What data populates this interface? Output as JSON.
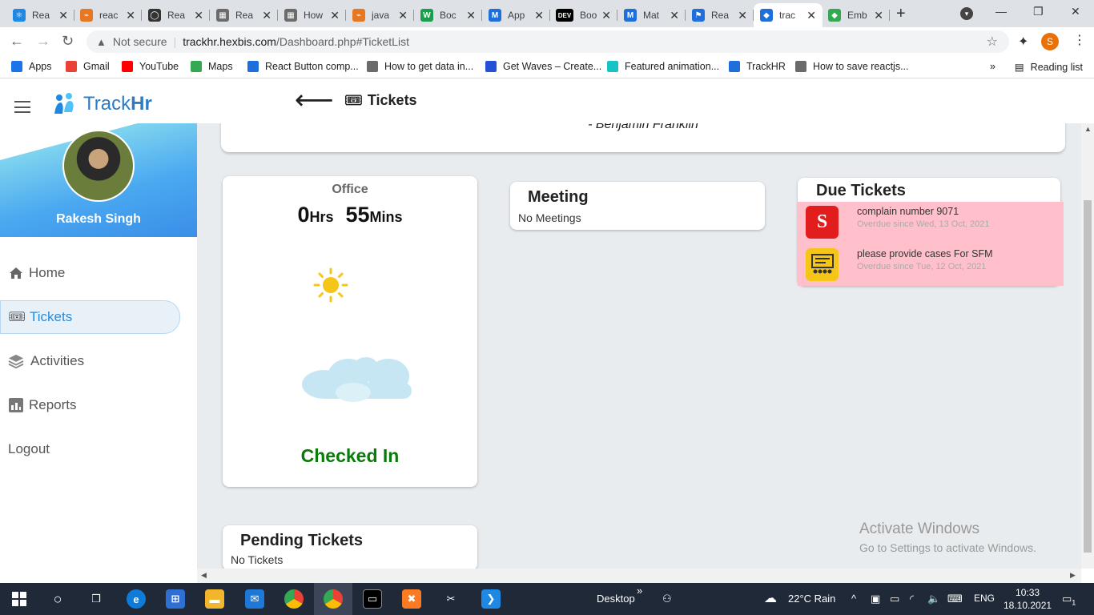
{
  "browser": {
    "tabs": [
      {
        "label": "Rea",
        "fav_color": "#1e88e5",
        "fav": "⚛"
      },
      {
        "label": "reac",
        "fav_color": "#e87722",
        "fav": "⌁"
      },
      {
        "label": "Rea",
        "fav_color": "#333333",
        "fav": "◯"
      },
      {
        "label": "Rea",
        "fav_color": "#6b6b6b",
        "fav": "▦"
      },
      {
        "label": "How",
        "fav_color": "#6b6b6b",
        "fav": "▦"
      },
      {
        "label": "java",
        "fav_color": "#e87722",
        "fav": "⌁"
      },
      {
        "label": "Boc",
        "fav_color": "#1b9e4b",
        "fav": "W"
      },
      {
        "label": "App",
        "fav_color": "#1e6fd9",
        "fav": "M"
      },
      {
        "label": "Boo",
        "fav_color": "#000000",
        "fav": "DEV"
      },
      {
        "label": "Mat",
        "fav_color": "#1e6fd9",
        "fav": "M"
      },
      {
        "label": "Rea",
        "fav_color": "#1e6fd9",
        "fav": "⚑"
      },
      {
        "label": "trac",
        "fav_color": "#1e6fd9",
        "fav": "◆"
      },
      {
        "label": "Emb",
        "fav_color": "#34a853",
        "fav": "◆"
      }
    ],
    "address": {
      "warning": "Not secure",
      "host": "trackhr.hexbis.com",
      "path": "/Dashboard.php#TicketList"
    },
    "profile_initial": "S",
    "bookmarks": [
      {
        "label": "Apps",
        "color": "#1a73e8"
      },
      {
        "label": "Gmail",
        "color": "#ea4335"
      },
      {
        "label": "YouTube",
        "color": "#ff0000"
      },
      {
        "label": "Maps",
        "color": "#34a853"
      },
      {
        "label": "React Button comp...",
        "color": "#1e6fd9"
      },
      {
        "label": "How to get data in...",
        "color": "#6b6b6b"
      },
      {
        "label": "Get Waves – Create...",
        "color": "#2451d6"
      },
      {
        "label": "Featured animation...",
        "color": "#16c4c4"
      },
      {
        "label": "TrackHR",
        "color": "#1e6fd9"
      },
      {
        "label": "How to save reactjs...",
        "color": "#6b6b6b"
      }
    ],
    "more_bookmarks": "»",
    "reading_list": "Reading list"
  },
  "app": {
    "brand_plain": "Track",
    "brand_bold": "Hr",
    "user_name": "Rakesh Singh",
    "menu": [
      {
        "label": "Home",
        "icon": "home-icon"
      },
      {
        "label": "Tickets",
        "icon": "ticket-icon"
      },
      {
        "label": "Activities",
        "icon": "layers-icon"
      },
      {
        "label": "Reports",
        "icon": "report-icon"
      },
      {
        "label": "Logout",
        "icon": ""
      }
    ],
    "page_title": "Tickets",
    "quote_author": "- Benjamin Franklin",
    "office": {
      "label": "Office",
      "hours": "0",
      "hours_unit": "Hrs",
      "mins": "55",
      "mins_unit": "Mins",
      "status": "Checked In"
    },
    "meeting": {
      "title": "Meeting",
      "empty": "No Meetings"
    },
    "due_tickets": {
      "title": "Due Tickets",
      "items": [
        {
          "title": "complain number 9071",
          "meta": "Overdue since Wed, 13 Oct, 2021",
          "icon_color": "#e11d1d",
          "icon": "S"
        },
        {
          "title": "please provide cases For SFM",
          "meta": "Overdue since Tue, 12 Oct, 2021",
          "icon_color": "#f5c518",
          "icon": "▦"
        }
      ]
    },
    "pending": {
      "title": "Pending Tickets",
      "empty": "No Tickets"
    },
    "watermark": {
      "line1": "Activate Windows",
      "line2": "Go to Settings to activate Windows."
    }
  },
  "taskbar": {
    "desktop_label": "Desktop",
    "weather": "22°C  Rain",
    "language": "ENG",
    "time": "10:33",
    "date": "18.10.2021",
    "notifications": "1"
  }
}
